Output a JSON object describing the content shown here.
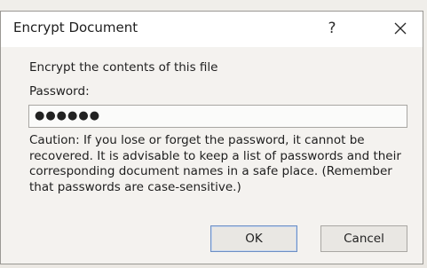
{
  "window": {
    "title": "Encrypt Document",
    "help_glyph": "?",
    "close_icon": "close-icon"
  },
  "group": {
    "label": "Encrypt the contents of this file"
  },
  "password": {
    "label_prefix": "Password",
    "label_mnemonic": "",
    "label_suffix": ":",
    "masked_value": "●●●●●●"
  },
  "caution": {
    "text": "Caution: If you lose or forget the password, it cannot be recovered. It is advisable to keep a list of passwords and their corresponding document names in a safe place. (Remember that passwords are case-sensitive.)"
  },
  "buttons": {
    "ok_label": "OK",
    "cancel_label": "Cancel"
  }
}
